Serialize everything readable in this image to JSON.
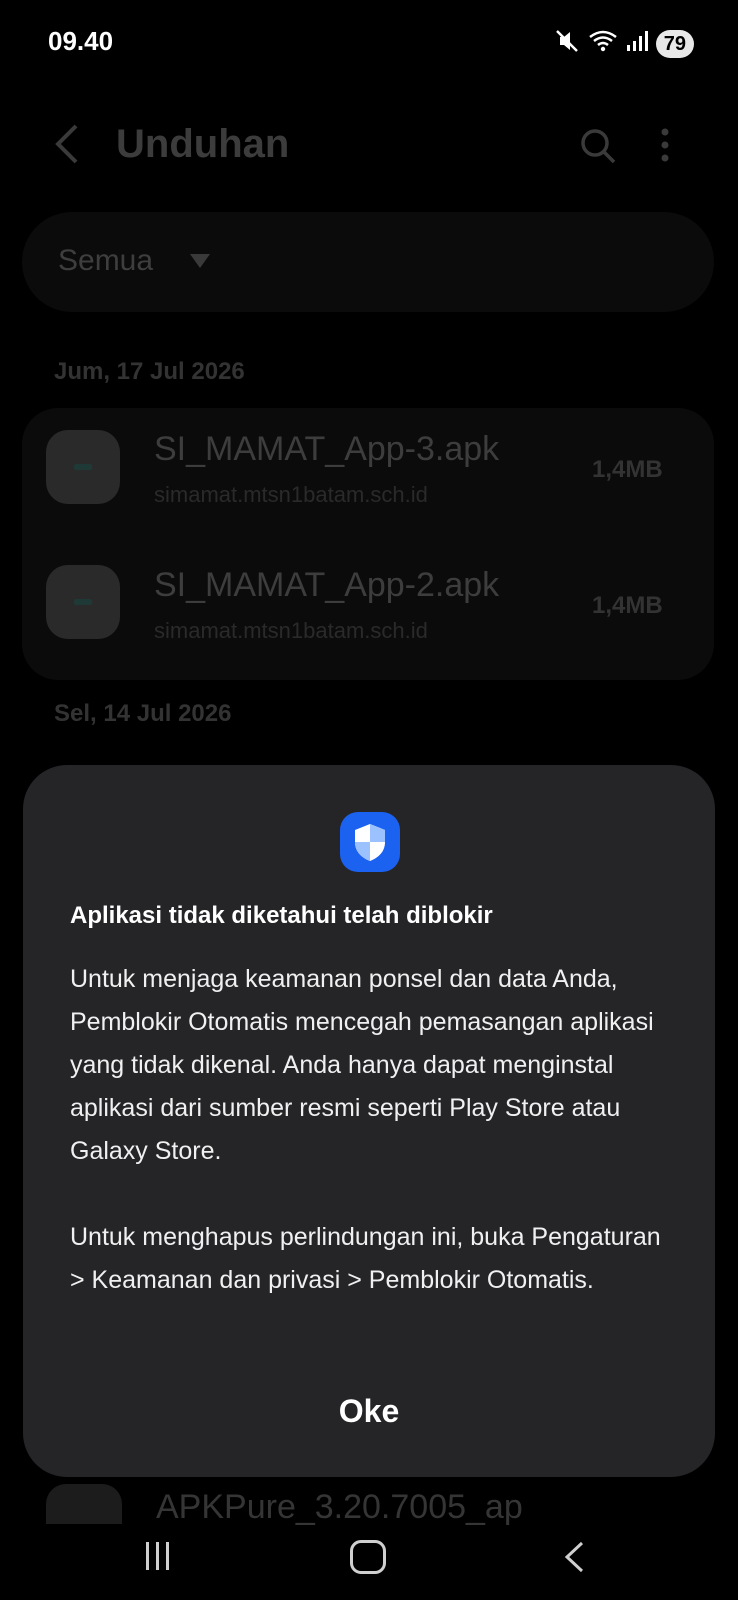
{
  "status_bar": {
    "time": "09.40",
    "battery": "79"
  },
  "app": {
    "title": "Unduhan",
    "filter": "Semua",
    "sections": [
      {
        "date": "Jum, 17 Jul 2026",
        "files": [
          {
            "name": "SI_MAMAT_App-3.apk",
            "source": "simamat.mtsn1batam.sch.id",
            "size": "1,4MB"
          },
          {
            "name": "SI_MAMAT_App-2.apk",
            "source": "simamat.mtsn1batam.sch.id",
            "size": "1,4MB"
          }
        ]
      },
      {
        "date": "Sel, 14 Jul 2026"
      }
    ],
    "partial_item": "APKPure_3.20.7005_ap"
  },
  "dialog": {
    "icon": "shield-icon",
    "title": "Aplikasi tidak diketahui telah diblokir",
    "body_1": "Untuk menjaga keamanan ponsel dan data Anda, Pemblokir Otomatis mencegah pemasangan aplikasi yang tidak dikenal. Anda hanya dapat menginstal aplikasi dari sumber resmi seperti Play Store atau Galaxy Store.",
    "body_2": "Untuk menghapus perlindungan ini, buka Pengaturan > Keamanan dan privasi > Pemblokir Otomatis.",
    "ok_label": "Oke",
    "accent": "#1b62f0"
  }
}
